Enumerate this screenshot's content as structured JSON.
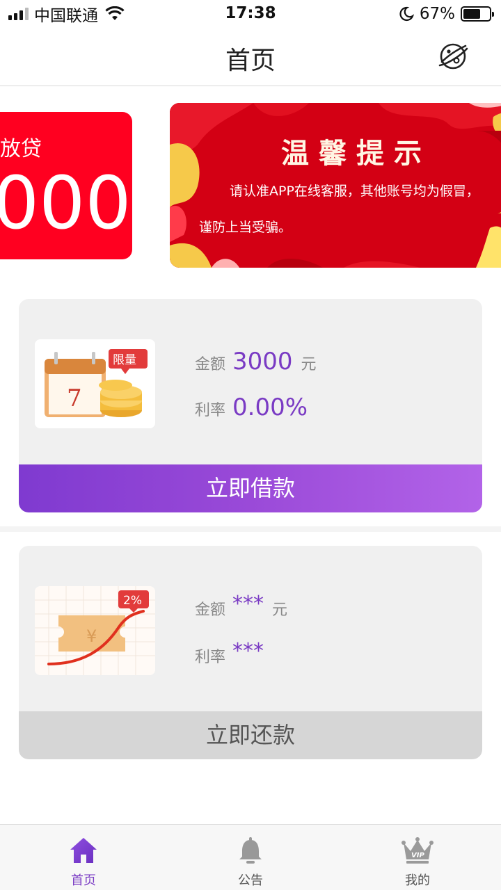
{
  "status_bar": {
    "carrier": "中国联通",
    "time": "17:38",
    "battery": "67%",
    "battery_level": 0.67
  },
  "nav": {
    "title": "首页",
    "right_icon": "planet-icon"
  },
  "banner": {
    "prev_slide": {
      "label": "放贷",
      "amount": "000"
    },
    "notice": {
      "title": "温馨提示",
      "line1": "请认准APP在线客服，其他账号均为假冒，",
      "line2": "谨防上当受骗。"
    }
  },
  "borrow_card": {
    "amount_label": "金额",
    "amount": "3000",
    "amount_unit": "元",
    "rate_label": "利率",
    "rate": "0.00%",
    "badge": "限量",
    "calendar_day": "7",
    "button": "立即借款",
    "accent": "#7a3bc4"
  },
  "repay_card": {
    "amount_label": "金额",
    "amount": "***",
    "amount_unit": "元",
    "rate_label": "利率",
    "rate": "***",
    "badge": "2%",
    "button": "立即还款"
  },
  "tabbar": {
    "items": [
      {
        "label": "首页",
        "icon": "home-icon",
        "active": true
      },
      {
        "label": "公告",
        "icon": "bell-icon",
        "active": false
      },
      {
        "label": "我的",
        "icon": "vip-crown-icon",
        "active": false
      }
    ]
  }
}
